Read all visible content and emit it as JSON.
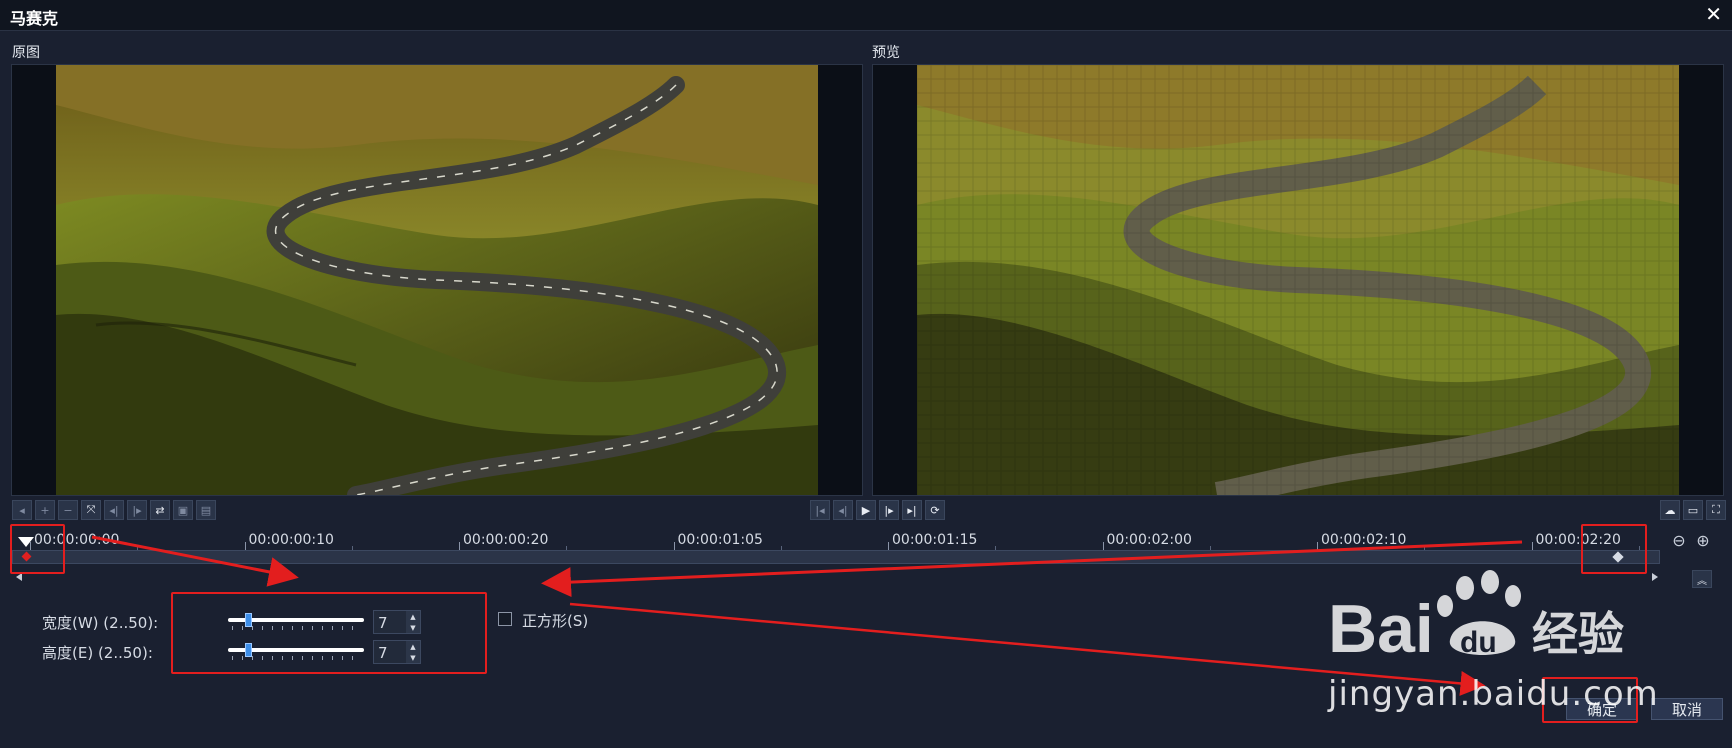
{
  "window": {
    "title": "马赛克",
    "close_glyph": "✕"
  },
  "panes": {
    "original_label": "原图",
    "preview_label": "预览"
  },
  "timeline": {
    "labels": [
      "00:00:00:00",
      "00:00:00:10",
      "00:00:00:20",
      "00:00:01:05",
      "00:00:01:15",
      "00:00:02:00",
      "00:00:02:10",
      "00:00:02:20"
    ]
  },
  "params": {
    "width_label": "宽度(W) (2..50):",
    "width_value": "7",
    "height_label": "高度(E) (2..50):",
    "height_value": "7",
    "range_min": 2,
    "range_max": 50
  },
  "square": {
    "label": "正方形(S)",
    "checked": false
  },
  "buttons": {
    "ok": "确定",
    "cancel": "取消"
  },
  "watermark": {
    "text": "jingyan.baidu.com",
    "brand": "Bai du 经验"
  },
  "colors": {
    "annotation": "#e31e1e",
    "background": "#1a2030",
    "slider_thumb": "#3d8ee8"
  }
}
